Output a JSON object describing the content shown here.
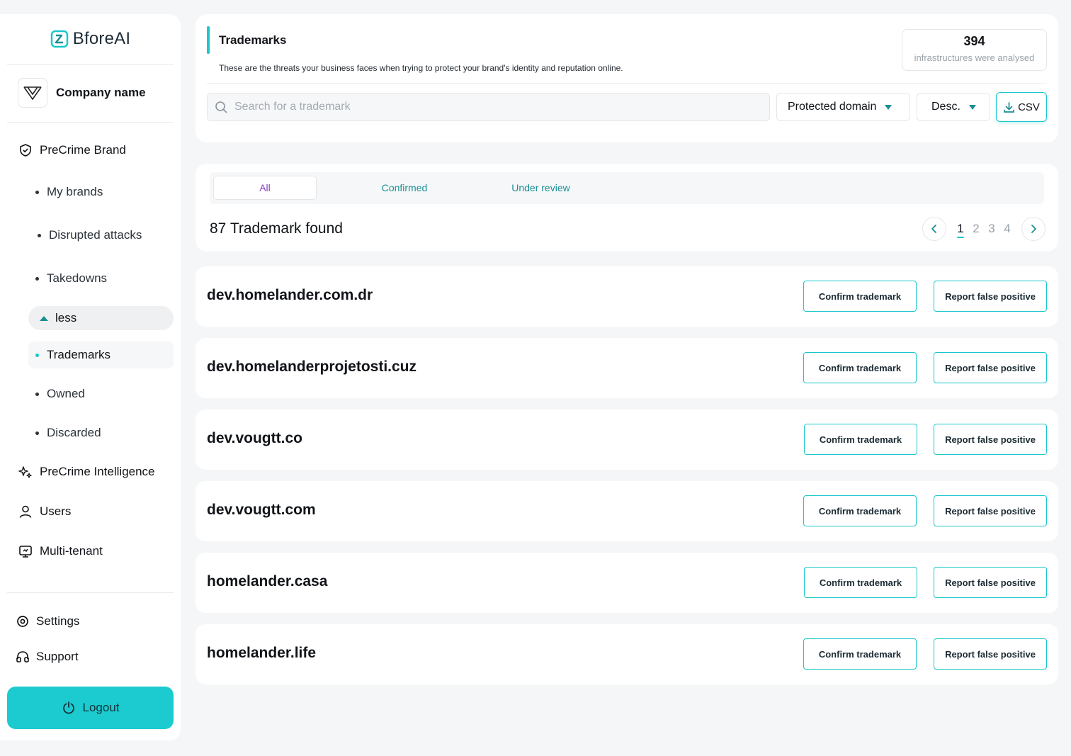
{
  "brand": {
    "name": "BforeAI",
    "accent": "#19c7cc"
  },
  "company": {
    "name": "Company name"
  },
  "sidebar": {
    "precrime_brand": "PreCrime Brand",
    "sub_items": [
      "My brands",
      "Disrupted attacks",
      "Takedowns"
    ],
    "less_label": "less",
    "sub_items_2": [
      "Trademarks",
      "Owned",
      "Discarded"
    ],
    "precrime_intel": "PreCrime Intelligence",
    "users": "Users",
    "multi_tenant": "Multi-tenant",
    "settings": "Settings",
    "support": "Support",
    "logout": "Logout"
  },
  "header": {
    "title": "Trademarks",
    "description": "These are the threats your business faces when trying to protect your brand's identity and reputation online.",
    "stat_value": "394",
    "stat_label": "infrastructures were analysed",
    "search_placeholder": "Search for a trademark",
    "filter_select": "Protected domain",
    "sort_select": "Desc.",
    "csv_label": "CSV"
  },
  "tabs": {
    "items": [
      "All",
      "Confirmed",
      "Under review"
    ],
    "active": "All"
  },
  "results": {
    "found_label": "87 Trademark found",
    "pages": [
      "1",
      "2",
      "3",
      "4"
    ],
    "current_page": "1"
  },
  "rows": [
    {
      "domain": "dev.homelander.com.dr"
    },
    {
      "domain": "dev.homelanderprojetosti.cuz"
    },
    {
      "domain": "dev.vougtt.co"
    },
    {
      "domain": "dev.vougtt.com"
    },
    {
      "domain": "homelander.casa"
    },
    {
      "domain": "homelander.life"
    }
  ],
  "row_actions": {
    "confirm_label": "Confirm trademark",
    "report_label": "Report false positive"
  }
}
